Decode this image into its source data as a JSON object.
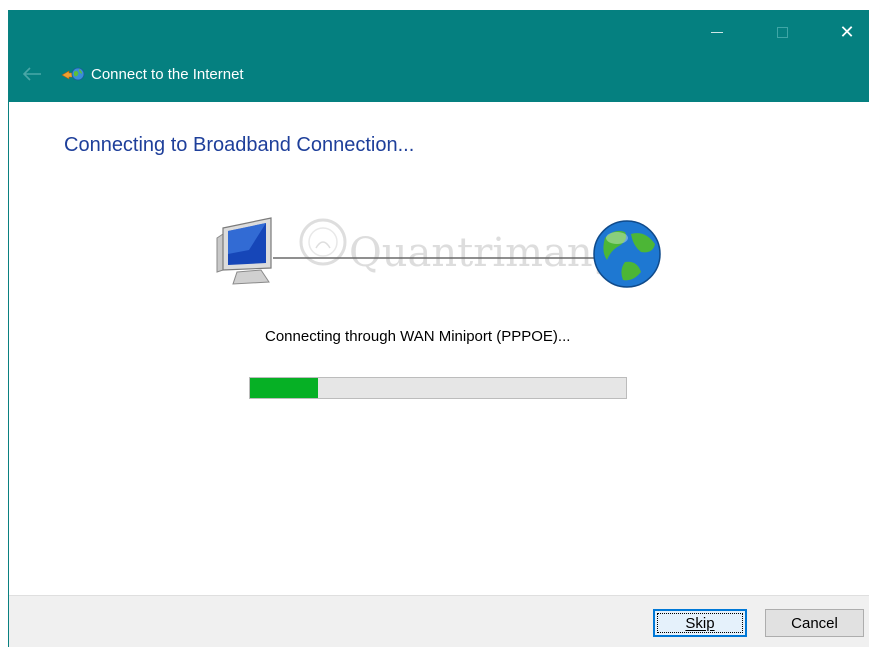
{
  "window": {
    "title": "Connect to the Internet",
    "icons": {
      "back": "back-arrow-icon",
      "app": "network-connect-icon",
      "minimize": "minimize-icon",
      "maximize": "maximize-icon",
      "close": "close-icon"
    },
    "close_glyph": "✕"
  },
  "main": {
    "heading": "Connecting to Broadband Connection...",
    "status": "Connecting through WAN Miniport (PPPOE)...",
    "progress": 0.18,
    "watermark": "Quantrimang"
  },
  "footer": {
    "skip_label": "Skip",
    "cancel_label": "Cancel"
  },
  "colors": {
    "titlebar": "#058080",
    "heading": "#1e3f9a",
    "progress_fill": "#06b025",
    "progress_track": "#e6e6e6"
  }
}
